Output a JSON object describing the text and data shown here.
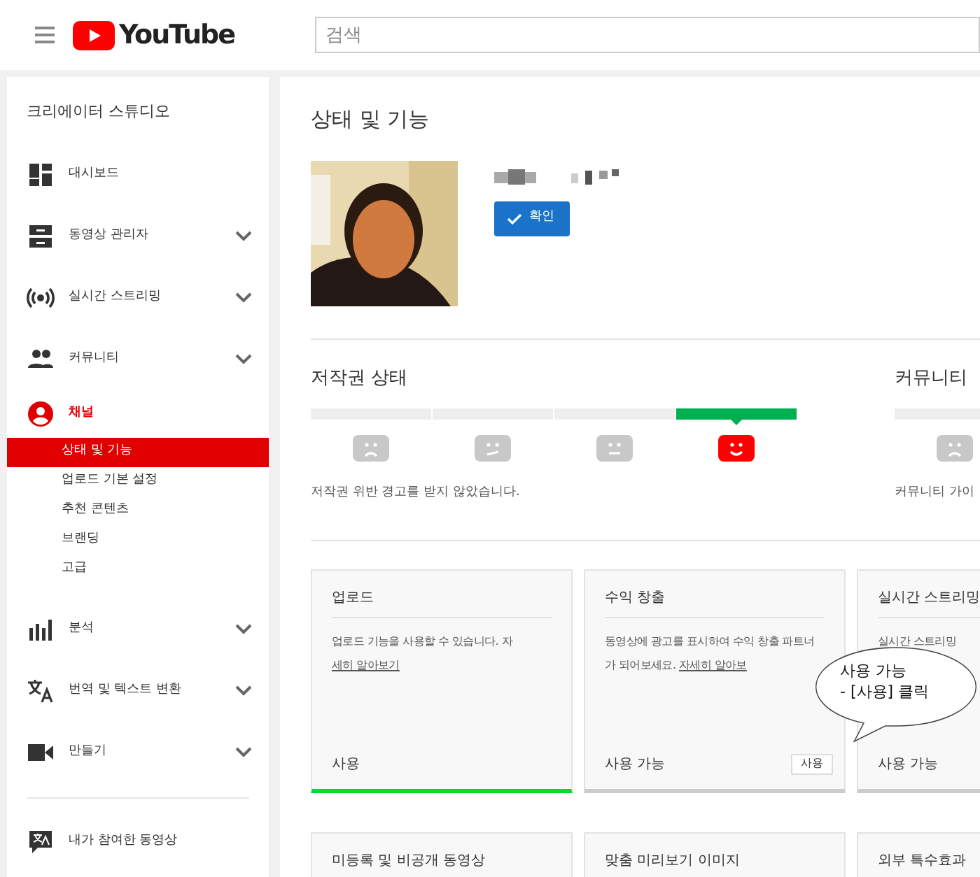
{
  "header": {
    "logo": "YouTube",
    "search": {
      "placeholder": "검색"
    }
  },
  "sidebar": {
    "title": "크리에이터 스튜디오",
    "items": [
      {
        "label": "대시보드",
        "expandable": false,
        "selected": false
      },
      {
        "label": "동영상 관리자",
        "expandable": true,
        "selected": false
      },
      {
        "label": "실시간 스트리밍",
        "expandable": true,
        "selected": false
      },
      {
        "label": "커뮤니티",
        "expandable": true,
        "selected": false
      },
      {
        "label": "채널",
        "expandable": false,
        "selected": true,
        "children": [
          {
            "label": "상태 및 기능",
            "selected": true
          },
          {
            "label": "업로드 기본 설정",
            "selected": false
          },
          {
            "label": "추천 콘텐츠",
            "selected": false
          },
          {
            "label": "브랜딩",
            "selected": false
          },
          {
            "label": "고급",
            "selected": false
          }
        ]
      },
      {
        "label": "분석",
        "expandable": true,
        "selected": false
      },
      {
        "label": "번역 및 텍스트 변환",
        "expandable": true,
        "selected": false
      },
      {
        "label": "만들기",
        "expandable": true,
        "selected": false
      }
    ],
    "footer_item": {
      "label": "내가 참여한 동영상"
    }
  },
  "main": {
    "title": "상태 및 기능",
    "verify_button": "확인",
    "statuses": [
      {
        "title": "저작권 상태",
        "segments": [
          {
            "selected": false
          },
          {
            "selected": false
          },
          {
            "selected": false
          },
          {
            "selected": true
          }
        ],
        "message": "저작권 위반 경고를 받지 않았습니다."
      },
      {
        "title": "커뮤니티",
        "segments": [
          {
            "selected": false
          }
        ],
        "message": "커뮤니티 가이"
      }
    ],
    "features": [
      {
        "title": "업로드",
        "description": "업로드 기능을 사용할 수 있습니다. 자",
        "link": "세히 알아보기",
        "status": "사용",
        "enabled": true
      },
      {
        "title": "수익 창출",
        "description": "동영상에 광고를 표시하여 수익 창출 파트너가 되어보세요.",
        "link": "자세히 알아보",
        "status": "사용 가능",
        "enabled": false,
        "button": "사용"
      },
      {
        "title": "실시간 스트리밍",
        "description": "실시간 스트리밍",
        "status": "사용 가능",
        "enabled": false
      }
    ],
    "features_row2": [
      {
        "title": "미등록 및 비공개 동영상"
      },
      {
        "title": "맞춤 미리보기 이미지"
      },
      {
        "title": "외부 특수효과"
      }
    ],
    "callout": {
      "lines": [
        "사용 가능",
        "- [사용] 클릭"
      ]
    }
  }
}
